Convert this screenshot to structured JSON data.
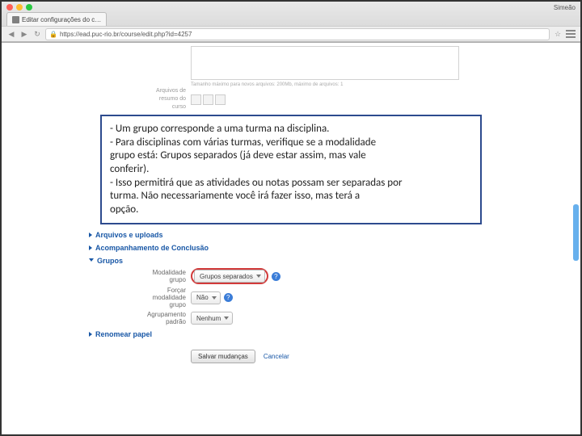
{
  "browser": {
    "tab_title": "Editar configurações do c…",
    "user_label": "Simeão",
    "url_display": "https://ead.puc-rio.br/course/edit.php?id=4257"
  },
  "upper_form": {
    "file_limit_hint": "Tamanho máximo para novos arquivos: 200Mb, máximo de arquivos: 1",
    "resume_files_label": "Arquivos de\nresumo do\ncurso"
  },
  "note": {
    "line1": "- Um grupo corresponde a uma turma na disciplina.",
    "line2": "- Para disciplinas com várias turmas, verifique se a modalidade",
    "line3": "  grupo está: Grupos separados (já deve estar assim, mas vale",
    "line4": "  conferir).",
    "line5": "- Isso permitirá que as atividades ou notas possam ser separadas por",
    "line6": "  turma. Não necessariamente você irá fazer isso, mas terá a",
    "line7": "  opção."
  },
  "sections": {
    "files": "Arquivos e uploads",
    "completion": "Acompanhamento de Conclusão",
    "groups": "Grupos",
    "rename": "Renomear papel"
  },
  "groups_form": {
    "mode_label": "Modalidade\ngrupo",
    "mode_value": "Grupos separados",
    "force_label": "Forçar\nmodalidade\ngrupo",
    "force_value": "Não",
    "default_group_label": "Agrupamento\npadrão",
    "default_group_value": "Nenhum",
    "help_glyph": "?"
  },
  "actions": {
    "save": "Salvar mudanças",
    "cancel": "Cancelar"
  }
}
